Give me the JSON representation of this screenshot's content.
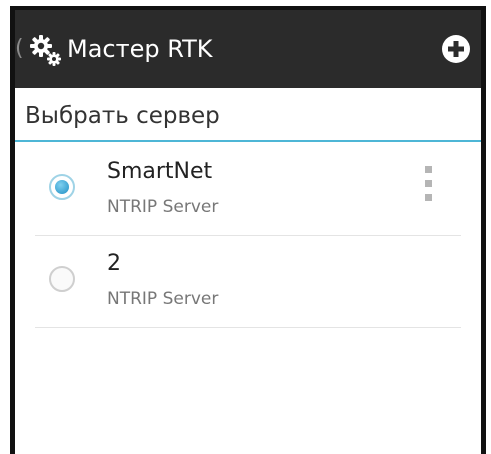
{
  "action_bar": {
    "up_caret": "(",
    "title": "Мастер RTK",
    "app_icon": "gears-icon",
    "add_icon": "add-circle-icon"
  },
  "subheader": {
    "title": "Выбрать сервер"
  },
  "servers": [
    {
      "name": "SmartNet",
      "type": "NTRIP Server",
      "selected": true,
      "has_menu": true
    },
    {
      "name": "2",
      "type": "NTRIP Server",
      "selected": false,
      "has_menu": false
    }
  ],
  "colors": {
    "action_bar_bg": "#2b2b2b",
    "accent": "#4db6d6",
    "radio_checked": "#1f8fc4"
  }
}
